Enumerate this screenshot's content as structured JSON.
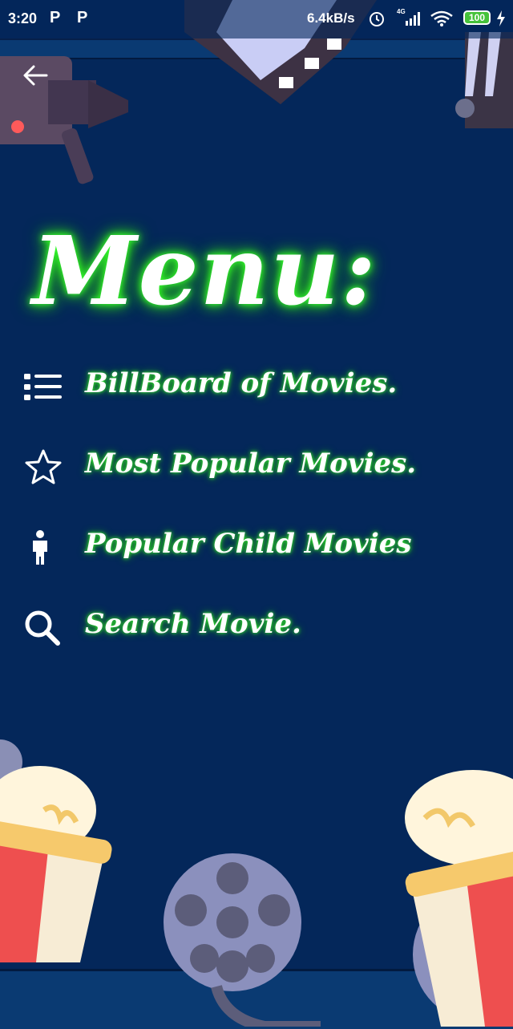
{
  "status_bar": {
    "time": "3:20",
    "notif1": "P",
    "notif2": "P",
    "net_speed": "6.4kB/s",
    "network": "4G",
    "battery": "100"
  },
  "header": {
    "back_icon": "arrow-left-icon"
  },
  "title": "Menu:",
  "menu": {
    "items": [
      {
        "label": "BillBoard of Movies.",
        "icon": "list-icon"
      },
      {
        "label": "Most Popular Movies.",
        "icon": "star-icon"
      },
      {
        "label": "Popular Child Movies",
        "icon": "child-icon"
      },
      {
        "label": "Search Movie.",
        "icon": "search-icon"
      }
    ]
  },
  "colors": {
    "background": "#04275a",
    "glow": "#37ff2d",
    "text": "#ffffff"
  }
}
